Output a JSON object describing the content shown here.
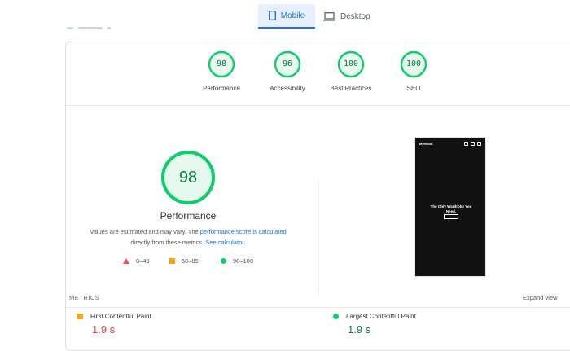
{
  "tabs": [
    {
      "label": "Mobile",
      "selected": true,
      "icon": "phone-icon"
    },
    {
      "label": "Desktop",
      "selected": false,
      "icon": "laptop-icon"
    }
  ],
  "categories": [
    {
      "score": "98",
      "label": "Performance"
    },
    {
      "score": "96",
      "label": "Accessibility"
    },
    {
      "score": "100",
      "label": "Best Practices"
    },
    {
      "score": "100",
      "label": "SEO"
    }
  ],
  "performance": {
    "score": "98",
    "title": "Performance",
    "note_prefix": "Values are estimated and may vary. The ",
    "note_link1": "performance score is calculated",
    "note_middle": " directly from these metrics. ",
    "note_link2": "See calculator."
  },
  "legend": [
    {
      "range": "0–49",
      "color": "#ff4e42"
    },
    {
      "range": "50–89",
      "color": "#ffa400"
    },
    {
      "range": "90–100",
      "color": "#0cce6b"
    }
  ],
  "screenshot": {
    "brand": "Mymood",
    "headline_1": "The Only Wardrobe You",
    "headline_2": "Need."
  },
  "metrics_section": {
    "heading": "METRICS",
    "expand_label": "Expand view"
  },
  "metrics": [
    {
      "name": "First Contentful Paint",
      "value": "1.9 s",
      "color": "#e8453c",
      "marker": "square"
    },
    {
      "name": "Largest Contentful Paint",
      "value": "1.9 s",
      "color": "#0c7b3c",
      "marker": "circle"
    }
  ],
  "colors": {
    "accent": "#1a73e8",
    "pass": "#0cce6b",
    "pass_text": "#0c7b3c",
    "average": "#ffa400",
    "fail": "#ff4e42"
  }
}
